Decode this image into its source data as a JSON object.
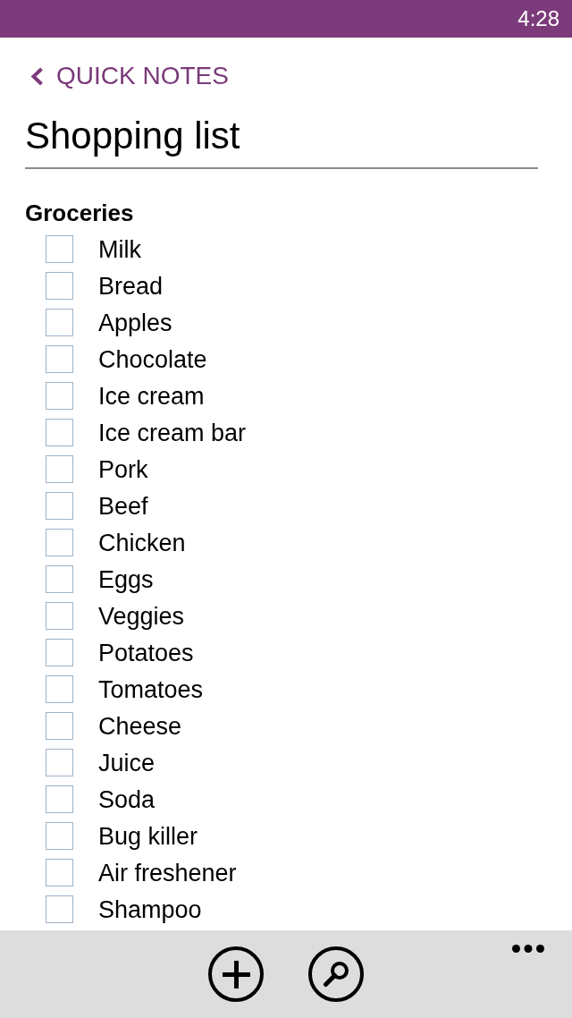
{
  "status_bar": {
    "time": "4:28"
  },
  "back_link": {
    "label": "QUICK NOTES"
  },
  "page": {
    "title": "Shopping list"
  },
  "sections": [
    {
      "heading": "Groceries",
      "items": [
        {
          "label": "Milk",
          "checked": false
        },
        {
          "label": "Bread",
          "checked": false
        },
        {
          "label": "Apples",
          "checked": false
        },
        {
          "label": "Chocolate",
          "checked": false
        },
        {
          "label": "Ice cream",
          "checked": false
        },
        {
          "label": "Ice cream bar",
          "checked": false
        },
        {
          "label": "Pork",
          "checked": false
        },
        {
          "label": "Beef",
          "checked": false
        },
        {
          "label": "Chicken",
          "checked": false
        },
        {
          "label": "Eggs",
          "checked": false
        },
        {
          "label": "Veggies",
          "checked": false
        },
        {
          "label": "Potatoes",
          "checked": false
        },
        {
          "label": "Tomatoes",
          "checked": false
        },
        {
          "label": "Cheese",
          "checked": false
        },
        {
          "label": "Juice",
          "checked": false
        },
        {
          "label": "Soda",
          "checked": false
        },
        {
          "label": "Bug killer",
          "checked": false
        },
        {
          "label": "Air freshener",
          "checked": false
        },
        {
          "label": "Shampoo",
          "checked": false
        }
      ]
    }
  ]
}
